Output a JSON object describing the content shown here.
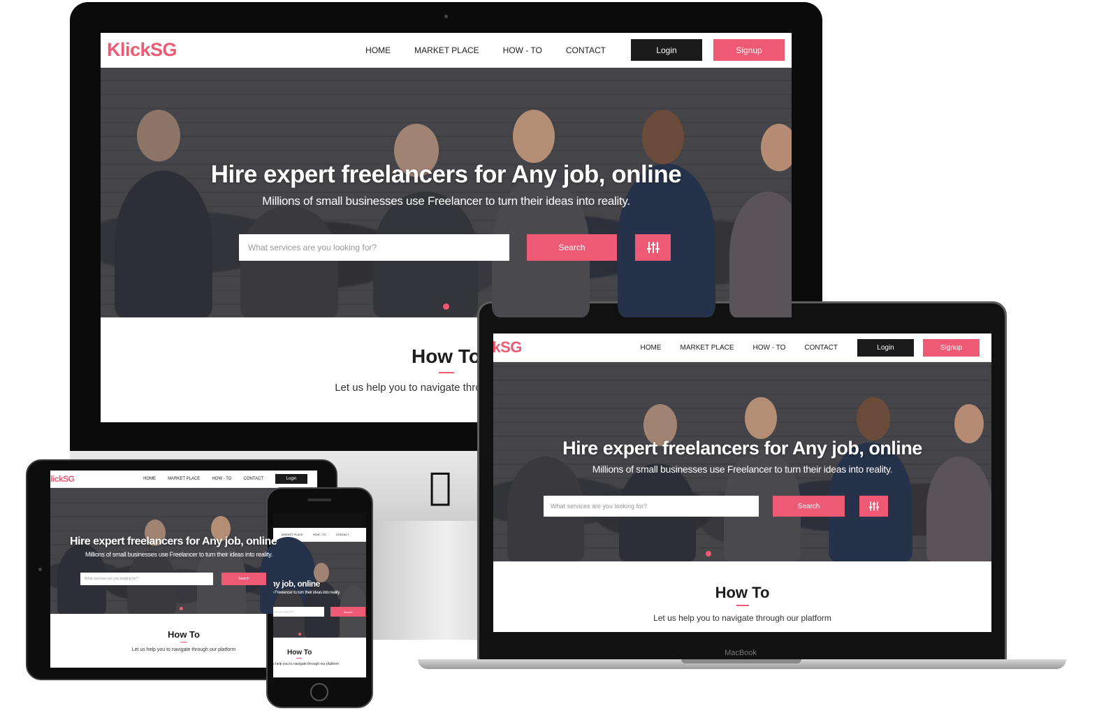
{
  "brand": {
    "logo": "KlickSG",
    "accent": "#ee5a74",
    "dark": "#1b1b1b"
  },
  "nav": {
    "items": [
      "HOME",
      "MARKET PLACE",
      "HOW - TO",
      "CONTACT"
    ],
    "login": "Login",
    "signup": "Signup"
  },
  "hero": {
    "title": "Hire expert freelancers for Any job, online",
    "subtitle": "Millions of small businesses use Freelancer to turn their ideas into reality.",
    "search_placeholder": "What services are you looking for?",
    "search_button": "Search",
    "filter_icon": "sliders-icon"
  },
  "howto": {
    "title": "How To",
    "subtitle": "Let us help you to navigate through our platform"
  },
  "devices": {
    "macbook_label": "MacBook"
  }
}
